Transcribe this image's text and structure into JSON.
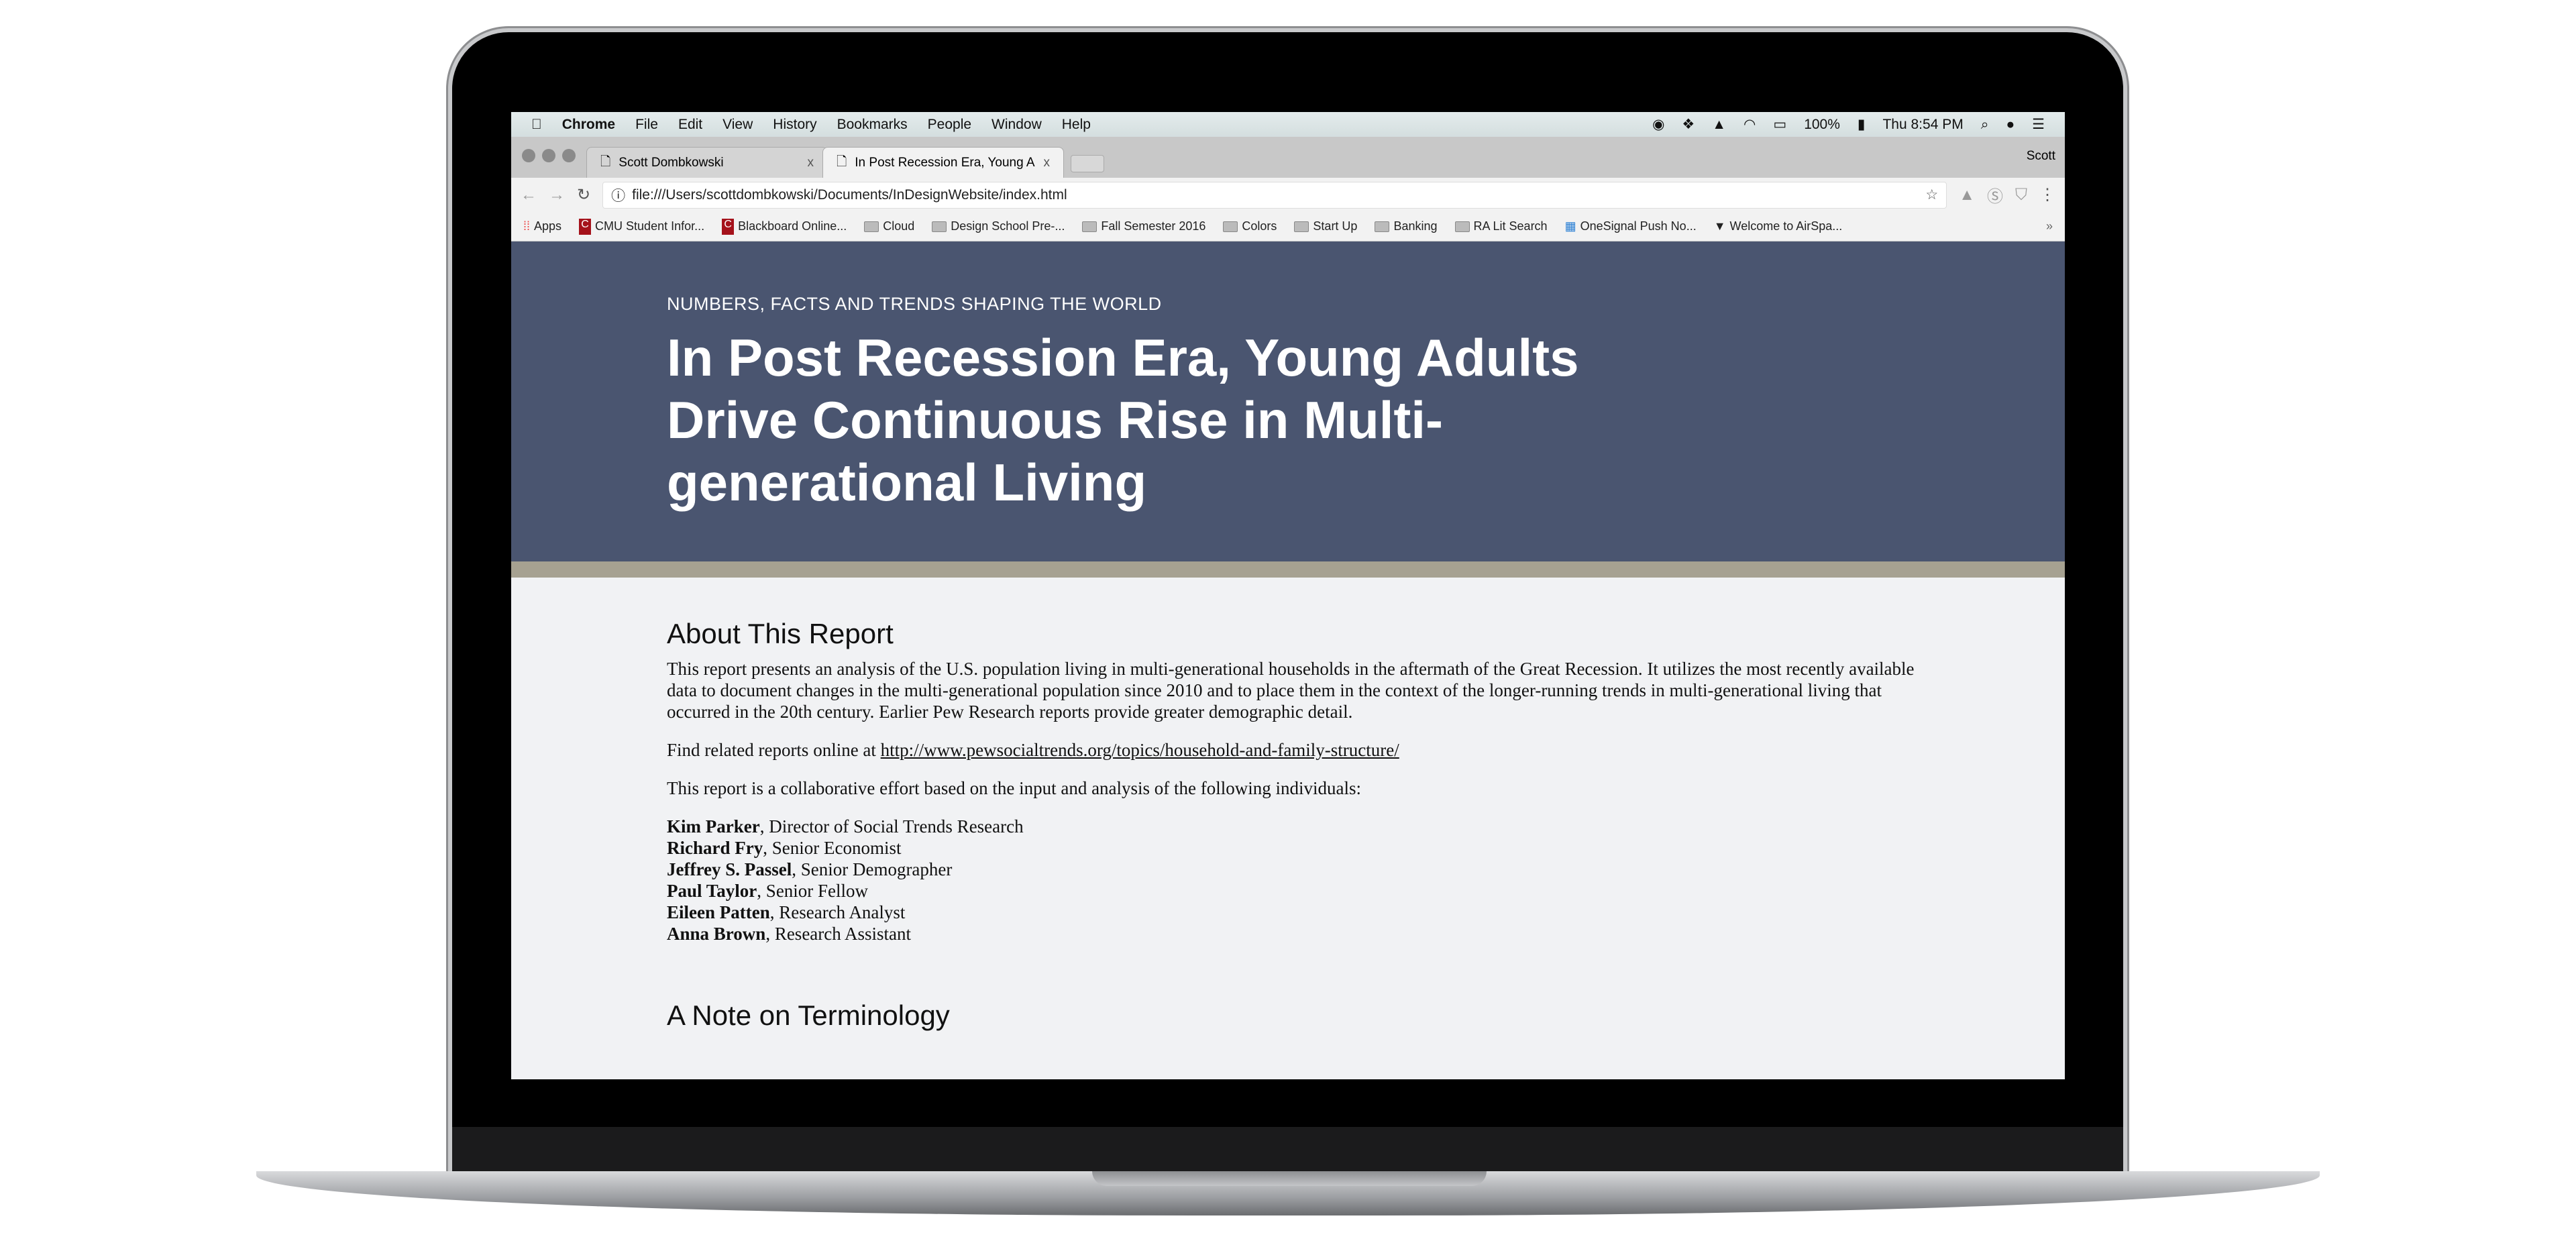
{
  "menubar": {
    "app": "Chrome",
    "items": [
      "File",
      "Edit",
      "View",
      "History",
      "Bookmarks",
      "People",
      "Window",
      "Help"
    ],
    "battery": "100%",
    "clock": "Thu 8:54 PM"
  },
  "tabs": [
    {
      "label": "Scott Dombkowski",
      "close": "x"
    },
    {
      "label": "In Post Recession Era, Young A",
      "close": "x"
    }
  ],
  "profile": "Scott",
  "address": {
    "url": "file:///Users/scottdombkowski/Documents/InDesignWebsite/index.html"
  },
  "bookmarks": [
    {
      "label": "Apps",
      "icon": "apps-grid-icon"
    },
    {
      "label": "CMU Student Infor...",
      "icon": "cmu-icon"
    },
    {
      "label": "Blackboard Online...",
      "icon": "cmu-icon"
    },
    {
      "label": "Cloud",
      "icon": "folder-icon"
    },
    {
      "label": "Design School Pre-...",
      "icon": "folder-icon"
    },
    {
      "label": "Fall Semester 2016",
      "icon": "folder-icon"
    },
    {
      "label": "Colors",
      "icon": "folder-icon"
    },
    {
      "label": "Start Up",
      "icon": "folder-icon"
    },
    {
      "label": "Banking",
      "icon": "folder-icon"
    },
    {
      "label": "RA Lit Search",
      "icon": "folder-icon"
    },
    {
      "label": "OneSignal Push No...",
      "icon": "onesignal-icon"
    },
    {
      "label": "Welcome to AirSpa...",
      "icon": "airspace-icon"
    }
  ],
  "bookmarks_more": "»",
  "hero": {
    "kicker": "NUMBERS, FACTS AND TRENDS SHAPING THE WORLD",
    "title": "In Post Recession Era, Young Adults Drive Continuous Rise in Multi-generational Living",
    "bg": "#4a5570",
    "strip": "#a6a191"
  },
  "about": {
    "heading": "About This Report",
    "p1": "This report presents an analysis of the U.S. population living in multi-generational households in the aftermath of the Great Recession. It utilizes the most recently available data to document changes in the multi-generational population since 2010 and to place them in the context of the longer-running trends in multi-generational living that occurred in the 20th century. Earlier Pew Research reports provide greater demographic detail.",
    "p2_prefix": "Find related reports online at ",
    "p2_link": "http://www.pewsocialtrends.org/topics/household-and-family-structure/",
    "p3": "This report is a collaborative effort based on the input and analysis of the following individuals:",
    "people": [
      {
        "name": "Kim Parker",
        "role": ", Director of Social Trends Research"
      },
      {
        "name": "Richard Fry",
        "role": ", Senior Economist"
      },
      {
        "name": "Jeffrey S. Passel",
        "role": ", Senior Demographer"
      },
      {
        "name": "Paul Taylor",
        "role": ", Senior Fellow"
      },
      {
        "name": "Eileen Patten",
        "role": ", Research Analyst"
      },
      {
        "name": "Anna Brown",
        "role": ", Research Assistant"
      }
    ]
  },
  "note": {
    "heading": "A Note on Terminology"
  }
}
